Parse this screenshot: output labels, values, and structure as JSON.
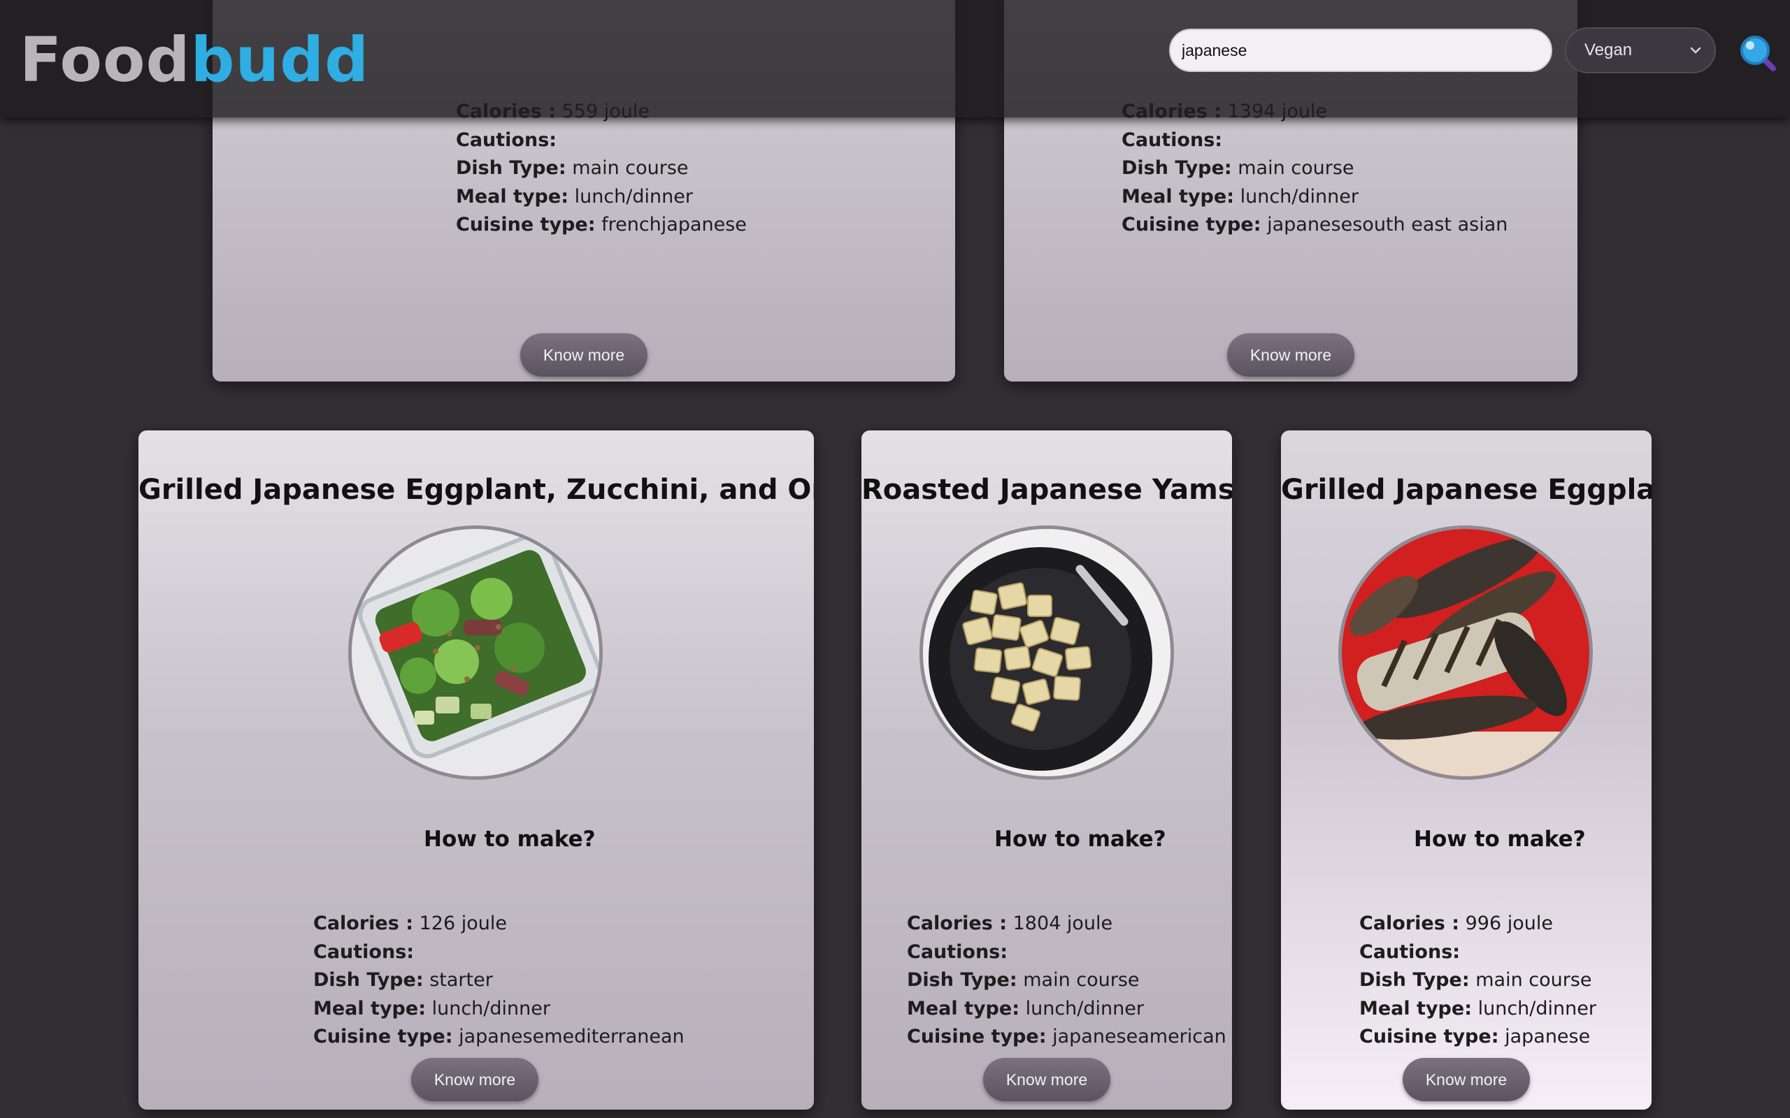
{
  "app": {
    "logo_part1": "Food",
    "logo_part2": "budd",
    "search_value": "japanese",
    "filter_selected": "Vegan",
    "search_icon": "magnifier-icon",
    "colors": {
      "brand_blue": "#2eaee3",
      "logo_gray": "#b9b4bc",
      "background": "#332f35",
      "button": "#5f5763"
    }
  },
  "labels": {
    "calories": "Calories :",
    "cautions": "Cautions:",
    "dish_type": "Dish Type:",
    "meal_type": "Meal type:",
    "cuisine_type": "Cuisine type:",
    "how_to": "How to make?",
    "button": "Know more"
  },
  "cards_top": [
    {
      "calories": "559 joule",
      "dish_type": "main course",
      "meal_type": "lunch/dinner",
      "cuisine_type": "frenchjapanese"
    },
    {
      "calories": "1394 joule",
      "dish_type": "main course",
      "meal_type": "lunch/dinner",
      "cuisine_type": "japanesesouth east asian"
    }
  ],
  "cards": [
    {
      "title": "Grilled Japanese Eggplant, Zucchini, and Onions",
      "calories": "126 joule",
      "dish_type": "starter",
      "meal_type": "lunch/dinner",
      "cuisine_type": "japanesemediterranean"
    },
    {
      "title": "Roasted Japanese Yams",
      "calories": "1804 joule",
      "dish_type": "main course",
      "meal_type": "lunch/dinner",
      "cuisine_type": "japaneseamerican"
    },
    {
      "title": "Grilled Japanese Eggplant",
      "calories": "996 joule",
      "dish_type": "main course",
      "meal_type": "lunch/dinner",
      "cuisine_type": "japanese"
    }
  ]
}
